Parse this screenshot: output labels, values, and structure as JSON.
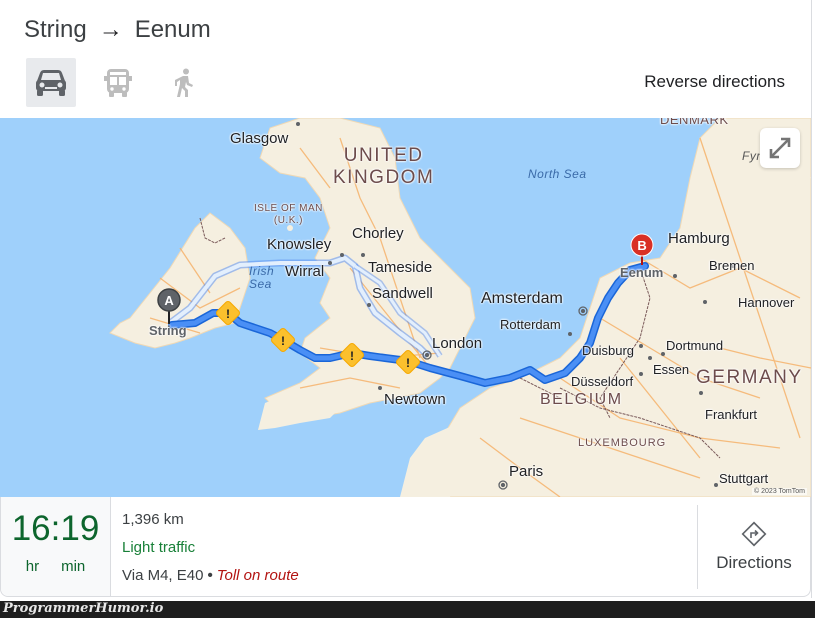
{
  "header": {
    "origin": "String",
    "arrow": "→",
    "destination": "Eenum",
    "reverse_label": "Reverse directions"
  },
  "travel_modes": [
    {
      "name": "car-icon",
      "label": "Driving",
      "active": true
    },
    {
      "name": "bus-icon",
      "label": "Transit",
      "active": false
    },
    {
      "name": "walk-icon",
      "label": "Walking",
      "active": false
    }
  ],
  "map": {
    "colors": {
      "water": "#9fd0fb",
      "land": "#f7f0e1",
      "route": "#4285f4",
      "route_alt": "#bcd8fb",
      "warning": "#fbc02d",
      "pin_a": "#5f6368",
      "pin_b": "#d93025"
    },
    "labels": {
      "glasgow": "Glasgow",
      "uk": "UNITED\nKINGDOM",
      "north_sea": "North Sea",
      "denmark": "DENMARK",
      "fyn": "Fyn",
      "isle_of_man": "ISLE OF MAN\n(U.K.)",
      "chorley": "Chorley",
      "knowsley": "Knowsley",
      "irish_sea": "Irish\nSea",
      "wirral": "Wirral",
      "tameside": "Tameside",
      "sandwell": "Sandwell",
      "london": "London",
      "newtown": "Newtown",
      "amsterdam": "Amsterdam",
      "rotterdam": "Rotterdam",
      "hamburg": "Hamburg",
      "bremen": "Bremen",
      "hannover": "Hannover",
      "duisburg": "Duisburg",
      "dortmund": "Dortmund",
      "essen": "Essen",
      "dusseldorf": "Düsseldorf",
      "germany": "GERMANY",
      "belgium": "BELGIUM",
      "frankfurt": "Frankfurt",
      "luxembourg": "LUXEMBOURG",
      "paris": "Paris",
      "stuttgart": "Stuttgart"
    },
    "pin_a": {
      "letter": "A",
      "label": "String"
    },
    "pin_b": {
      "letter": "B",
      "label": "Eenum"
    },
    "warnings_count": 4,
    "copyright": "© 2023 TomTom",
    "expand_label": "Expand map"
  },
  "summary": {
    "time": "16:19",
    "unit_hr": "hr",
    "unit_min": "min",
    "distance": "1,396 km",
    "traffic": "Light traffic",
    "via": "Via M4, E40",
    "separator": "•",
    "toll": "Toll on route",
    "directions_label": "Directions"
  },
  "footer": {
    "watermark": "ProgrammerHumor.io"
  }
}
